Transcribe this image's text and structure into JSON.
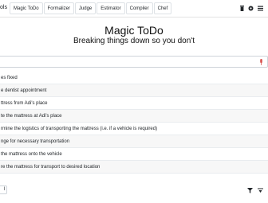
{
  "navbar": {
    "brand": "ols",
    "tabs": [
      "Magic ToDo",
      "Formalizer",
      "Judge",
      "Estimator",
      "Compiler",
      "Chef"
    ],
    "icons": [
      "trash-icon",
      "settings-icon",
      "list-icon"
    ]
  },
  "header": {
    "title": "Magic ToDo",
    "subtitle": "Breaking things down so you don't"
  },
  "task_input": {
    "value": "",
    "mic_icon": "microphone-icon"
  },
  "tasks": [
    "es fixed",
    "e dentist appointment",
    "ttress from Adi's place",
    "te the mattress at Adi's place",
    "rmine the logistics of transporting the mattress (i.e. if a vehicle is required)",
    "nge for necessary transportation",
    "the mattress onto the vehicle",
    "re the mattress for transport to desired location"
  ],
  "bottom_bar": {
    "left_select": "l",
    "filter_icon": "filter-icon",
    "sort_icon": "sort-icon"
  },
  "colors": {
    "accent": "#212529",
    "mic": "#d9534f",
    "row_alt": "#f7f7f7"
  }
}
